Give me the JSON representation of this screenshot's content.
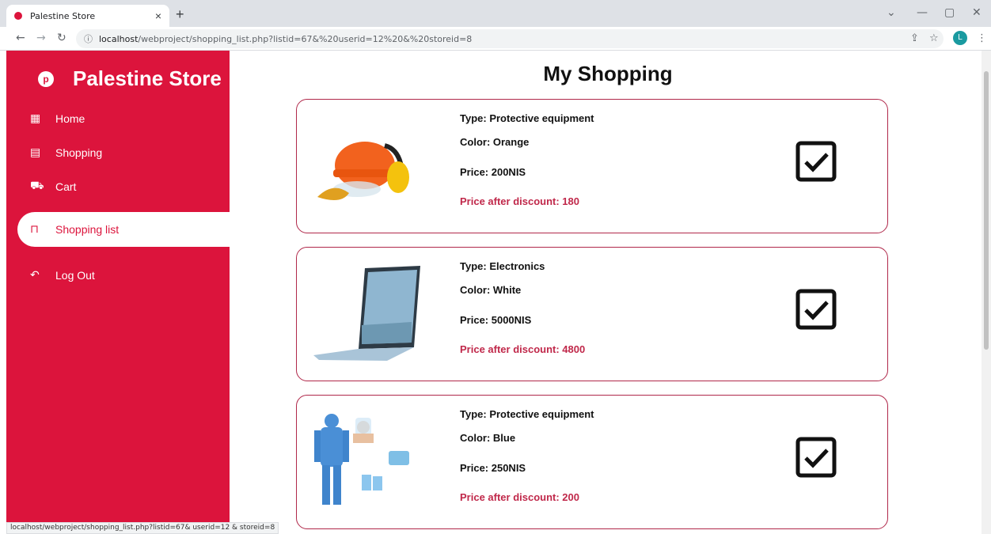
{
  "browser": {
    "tab_title": "Palestine Store",
    "tab_close": "×",
    "new_tab": "+",
    "url_host": "localhost",
    "url_path": "/webproject/shopping_list.php?listid=67&%20userid=12%20&%20storeid=8",
    "status_url": "localhost/webproject/shopping_list.php?listid=67& userid=12 & storeid=8"
  },
  "profile_initial": "L",
  "sidebar": {
    "brand": "Palestine Store",
    "items": [
      {
        "label": "Home",
        "icon": "grid-icon"
      },
      {
        "label": "Shopping",
        "icon": "store-icon"
      },
      {
        "label": "Cart",
        "icon": "cart-icon"
      },
      {
        "label": "Shopping list",
        "icon": "bag-icon"
      },
      {
        "label": "Log Out",
        "icon": "logout-icon"
      }
    ]
  },
  "main": {
    "title": "My Shopping",
    "items": [
      {
        "type": "Type: Protective equipment",
        "color": "Color: Orange",
        "price": "Price: 200NIS",
        "discount": "Price after discount: 180",
        "image": "safety-gear-image"
      },
      {
        "type": "Type: Electronics",
        "color": "Color: White",
        "price": "Price: 5000NIS",
        "discount": "Price after discount: 4800",
        "image": "laptop-image"
      },
      {
        "type": "Type: Protective equipment",
        "color": "Color: Blue",
        "price": "Price: 250NIS",
        "discount": "Price after discount: 200",
        "image": "protective-suit-image"
      }
    ]
  },
  "colors": {
    "brand": "#dc143c",
    "discount": "#c0284a",
    "card_border": "#b0284a"
  }
}
